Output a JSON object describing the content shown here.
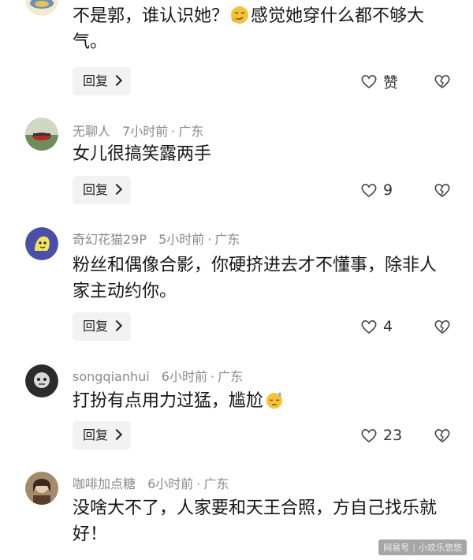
{
  "comments": [
    {
      "username": "",
      "time": "",
      "location": "",
      "text_before_emoji": "不是郭，谁认识她？",
      "emoji": "smirk-emoji",
      "text_after_emoji": "感觉她穿什么都不够大气。",
      "reply_label": "回复",
      "like_label": "赞"
    },
    {
      "username": "无聊人",
      "time": "7小时前",
      "location": "广东",
      "text": "女儿很搞笑露两手",
      "reply_label": "回复",
      "like_count": "9"
    },
    {
      "username": "奇幻花猫29P",
      "time": "5小时前",
      "location": "广东",
      "text": "粉丝和偶像合影，你硬挤进去才不懂事，除非人家主动约你。",
      "reply_label": "回复",
      "like_count": "4"
    },
    {
      "username": "songqianhui",
      "time": "6小时前",
      "location": "广东",
      "text_before_emoji": "打扮有点用力过猛，尴尬",
      "emoji": "sweat-emoji",
      "reply_label": "回复",
      "like_count": "23"
    },
    {
      "username": "咖啡加点糖",
      "time": "6小时前",
      "location": "广东",
      "text": "没啥大不了，人家要和天王合照，方自己找乐就好！",
      "reply_label": "回复",
      "like_count": ""
    }
  ],
  "separator": "·",
  "watermark": {
    "source": "网易号",
    "author": "小欢乐悠悠"
  },
  "colors": {
    "text": "#161616",
    "meta": "#8a8a8a",
    "reply_bg": "#f2f2f2"
  }
}
